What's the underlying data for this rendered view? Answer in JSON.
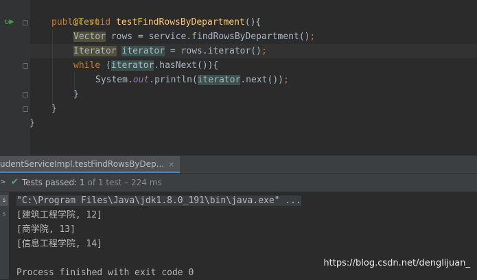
{
  "editor": {
    "annotation": "@Test",
    "line2": {
      "kw1": "public",
      "kw2": "void",
      "method": "testFindRowsByDepartment",
      "rest": "(){"
    },
    "line3": {
      "type": "Vector",
      "var": "rows",
      "mid": " = service.findRowsByDepartment()",
      "semi": ";"
    },
    "line4": {
      "type": "Iterator",
      "var": "iterator",
      "mid": " = rows.iterator()",
      "semi": ";"
    },
    "line5": {
      "kw": "while",
      "open": " (",
      "var": "iterator",
      "rest": ".hasNext()){"
    },
    "line6": {
      "pre": "System.",
      "field": "out",
      "mid": ".println(",
      "var": "iterator",
      "rest": ".next())",
      "semi": ";"
    },
    "close_inner": "}",
    "close_method": "}",
    "close_class": "}"
  },
  "run_panel": {
    "tab_label": "udentServiceImpl.testFindRowsByDep...",
    "tab_close": "×",
    "status": {
      "label": "Tests passed:",
      "count": "1",
      "of_text": "of 1 test",
      "duration": "– 224 ms"
    },
    "strip_buttons": [
      "s",
      "s"
    ],
    "output": [
      "\"C:\\Program Files\\Java\\jdk1.8.0_191\\bin\\java.exe\" ...",
      "[建筑工程学院, 12]",
      "[商学院, 13]",
      "[信息工程学院, 14]",
      "",
      "Process finished with exit code 0"
    ]
  },
  "watermark": "https://blog.csdn.net/denglijuan_",
  "colors": {
    "keyword": "#cc7832",
    "method": "#ffc66d",
    "annotation": "#bbb529",
    "pass_green": "#5aab5a",
    "background": "#2b2b2b"
  }
}
